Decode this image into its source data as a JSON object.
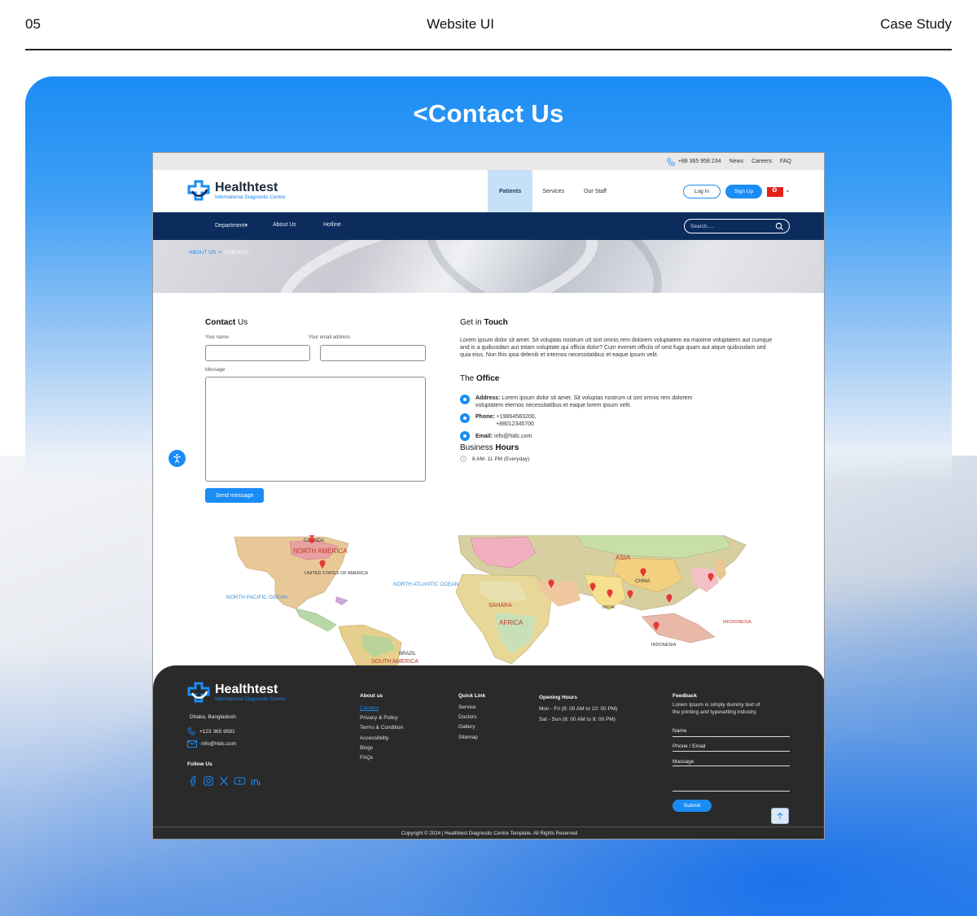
{
  "header": {
    "page_number": "05",
    "title": "Website UI",
    "tag": "Case Study"
  },
  "panel": {
    "title": "<Contact Us"
  },
  "topbar": {
    "phone": "+88 365 958 234",
    "links": [
      "News",
      "Careers",
      "FAQ"
    ]
  },
  "brand": {
    "name": "Healthtest",
    "tagline": "International Diagnostic Centre"
  },
  "nav": {
    "items": [
      "Patients",
      "Services",
      "Our Staff"
    ],
    "active": "Patients",
    "login": "Log In",
    "signup": "Sign Up"
  },
  "subnav": {
    "items": [
      "Department▾",
      "About Us",
      "Hotline"
    ],
    "search_placeholder": "Search....."
  },
  "breadcrumb": {
    "parent": "ABOUT US",
    "separator": ">",
    "current": "CONTACT"
  },
  "contact_form": {
    "heading_normal": "Contact",
    "heading_bold": "Us",
    "name_label": "Your name",
    "email_label": "Your email address",
    "message_label": "Message",
    "send_label": "Send message"
  },
  "get_in_touch": {
    "heading_normal": "Get in",
    "heading_bold": "Touch",
    "text": "Lorem ipsum dolor sit amet. Sit voluptas nostrum utt sint omnis rem  dolorem voluptatem ea maxime voluptatem aut cumque and is a quibusdam aut totam  voluptate qui officia dolor? Cum eveniet officiis of sest fuga quam aut  atque quibusdam sed quia eius. Non this ipsa deleniti et internos  necessitatibus et eaque ipsum velit."
  },
  "office": {
    "heading_normal": "The",
    "heading_bold": "Office",
    "address_label": "Address:",
    "address_line1": "Lorem ipsum dolor sit amet. Sit voluptas nostrum ut sint omnis rem  dolorem",
    "address_line2": "voluptatem eternos  necessitatibus et eaque lorem ipsum velit.",
    "phone_label": "Phone:",
    "phone_1": "+19864583200,",
    "phone_2": "+88012345700",
    "email_label": "Email:",
    "email": "info@hidc.com"
  },
  "hours": {
    "heading_normal": "Business",
    "heading_bold": "Hours",
    "value": "8 AM- 11 PM (Everyday)"
  },
  "map": {
    "labels": [
      "CANADA",
      "NORTH AMERICA",
      "UNITED STATES OF AMERICA",
      "NORTH PACIFIC OCEAN",
      "NORTH ATLANTIC OCEAN",
      "BRAZIL",
      "SOUTH AMERICA",
      "ASIA",
      "CHINA",
      "INDIA",
      "SAHARA",
      "AFRICA",
      "MICRONESIA",
      "INDONESIA"
    ]
  },
  "footer": {
    "location": "Dhaka, Bangladesh",
    "phone": "+123 365 9581",
    "email": "info@hidc.com",
    "follow_label": "Follow Us",
    "about_heading": "About us",
    "about_links": [
      "Careers",
      "Privacy & Policy",
      "Terms & Condition",
      "Accessibility",
      "Blogs",
      "FAQs"
    ],
    "quick_heading": "Quick Link",
    "quick_links": [
      "Service",
      "Doctors",
      "Gallery",
      "Sitemap"
    ],
    "hours_heading": "Opening Hours",
    "hours_lines": [
      "Mon - Fri (8: 00 AM to 10: 00 PM)",
      "Sat - Sun (8: 00 AM to 9: 00 PM)"
    ],
    "feedback_heading": "Feedback",
    "feedback_text_1": "Lorem Ipsum is simply dummy text of",
    "feedback_text_2": "the printing and  typesetting industry.",
    "fb_name": "Name",
    "fb_phone": "Phone / Email",
    "fb_message": "Massage",
    "submit_label": "Submit",
    "copyright": "Copyright © 2024 | Healthtest Diagnostic Centre Template. All Rights Reserved"
  },
  "colors": {
    "accent": "#1a8cf5",
    "navy": "#0b2c5c",
    "footer_bg": "#2a2a2a",
    "nav_active_bg": "#c6e0f8"
  }
}
